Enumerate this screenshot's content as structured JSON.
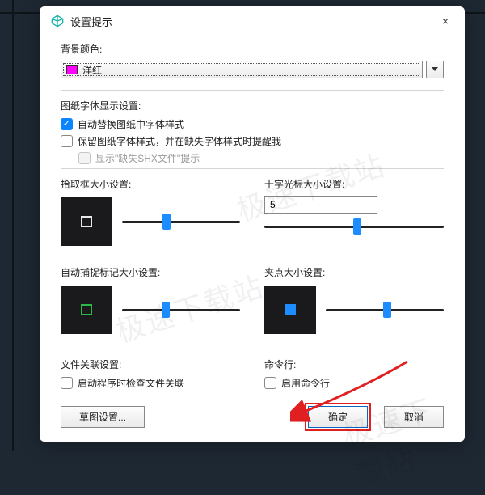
{
  "dialog": {
    "title": "设置提示",
    "close_label": "×"
  },
  "bg_color": {
    "label": "背景颜色:",
    "value": "洋红",
    "swatch_hex": "#ff00ff"
  },
  "font_settings": {
    "label": "图纸字体显示设置:",
    "replace": {
      "label": "自动替换图纸中字体样式",
      "checked": true
    },
    "keep": {
      "label": "保留图纸字体样式，并在缺失字体样式时提醒我",
      "checked": false
    },
    "show_missing": {
      "label": "显示\"缺失SHX文件\"提示",
      "checked": false,
      "disabled": true
    }
  },
  "pickbox": {
    "label": "拾取框大小设置:",
    "slider_percent": 38
  },
  "crosshair": {
    "label": "十字光标大小设置:",
    "value": "5",
    "slider_percent": 52
  },
  "snap": {
    "label": "自动捕捉标记大小设置:",
    "slider_percent": 37
  },
  "grip": {
    "label": "夹点大小设置:",
    "slider_percent": 52
  },
  "file_assoc": {
    "label": "文件关联设置:",
    "check": {
      "label": "启动程序时检查文件关联",
      "checked": false
    }
  },
  "cmdline": {
    "label": "命令行:",
    "check": {
      "label": "启用命令行",
      "checked": false
    }
  },
  "footer": {
    "sketch": "草图设置...",
    "ok": "确定",
    "cancel": "取消"
  },
  "watermark": "极速下载站"
}
